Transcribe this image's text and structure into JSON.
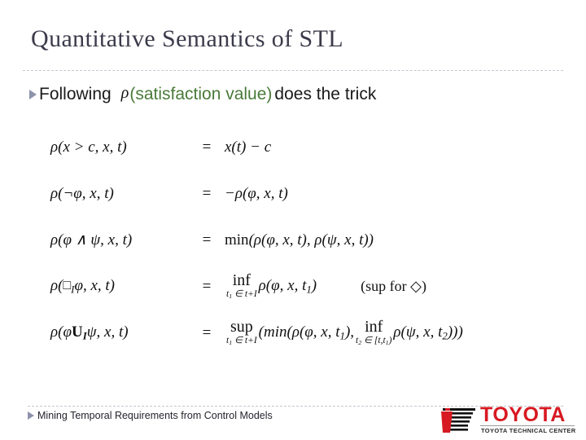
{
  "slide": {
    "title": "Quantitative Semantics of STL",
    "bullet": {
      "marker": "triangle-bullet",
      "lead_text": "Following",
      "rho_symbol": "ρ",
      "highlight_open": "(",
      "highlight_text": "satisfaction value",
      "highlight_close": ")",
      "tail_text": "does the trick",
      "highlight_color": "#4a7a3a"
    },
    "equations": [
      {
        "lhs": "ρ(x > c, x, t)",
        "relation": "=",
        "rhs": "x(t) − c",
        "note": ""
      },
      {
        "lhs": "ρ(¬φ, x, t)",
        "relation": "=",
        "rhs": "−ρ(φ, x, t)",
        "note": ""
      },
      {
        "lhs": "ρ(φ ∧ ψ, x, t)",
        "relation": "=",
        "rhs": "min(ρ(φ, x, t), ρ(ψ, x, t))",
        "note": ""
      },
      {
        "lhs": "ρ(□_I φ, x, t)",
        "relation": "=",
        "rhs": "inf_{t₁ ∈ t+I} ρ(φ, x, t₁)",
        "note": "(sup for ◇)"
      },
      {
        "lhs": "ρ(φ U_I ψ, x, t)",
        "relation": "=",
        "rhs": "sup_{t₁ ∈ t+I} (min(ρ(φ, x, t₁), inf_{t₂ ∈ [t,t₁)} ρ(ψ, x, t₂)))",
        "note": ""
      }
    ],
    "eq_tokens": {
      "r1_lhs_rho": "ρ",
      "r1_lhs_body": "(x > c, x, t)",
      "r1_rhs": "x(t) − c",
      "r2_lhs_rho": "ρ",
      "r2_lhs_body": "(¬φ, x, t)",
      "r2_rhs_sign": "−",
      "r2_rhs_rho": "ρ",
      "r2_rhs_body": "(φ, x, t)",
      "r3_lhs_rho": "ρ",
      "r3_lhs_body": "(φ ∧ ψ, x, t)",
      "r3_rhs_fn": "min",
      "r3_rhs_body": "(ρ(φ, x, t), ρ(ψ, x, t))",
      "r4_lhs_rho": "ρ",
      "r4_lhs_open": "(",
      "r4_lhs_box": "□",
      "r4_lhs_boxsub": "I",
      "r4_lhs_rest": "φ, x, t)",
      "r4_op": "inf",
      "r4_limit_a": "t",
      "r4_limit_sub": "1",
      "r4_limit_b": " ∈ t+I",
      "r4_rhs_tail": "ρ(φ, x, t",
      "r4_rhs_tail_sub": "1",
      "r4_rhs_tail_end": ")",
      "r4_note": "(sup for ◇)",
      "r5_lhs_rho": "ρ",
      "r5_lhs_open": "(φ",
      "r5_lhs_u": "U",
      "r5_lhs_usub": "I",
      "r5_lhs_rest": "ψ, x, t)",
      "r5_op": "sup",
      "r5_limit_a": "t",
      "r5_limit_sub": "1",
      "r5_limit_b": " ∈ t+I",
      "r5_mid_open": "(min(ρ(φ, x, t",
      "r5_mid_sub": "1",
      "r5_mid_close": "), ",
      "r5_op2": "inf",
      "r5_limit2_a": "t",
      "r5_limit2_sub": "2",
      "r5_limit2_b": " ∈ [t,t",
      "r5_limit2_sub2": "1",
      "r5_limit2_end": ")",
      "r5_tail": "ρ(ψ, x, t",
      "r5_tail_sub": "2",
      "r5_tail_end": ")))"
    },
    "footer": {
      "marker": "triangle-bullet",
      "text": "Mining Temporal Requirements from Control Models"
    },
    "logo": {
      "wordmark": "TOYOTA",
      "subtitle": "TOYOTA TECHNICAL CENTER",
      "wordmark_color": "#d71921",
      "mark_color_black": "#111111",
      "mark_color_red": "#d71921"
    }
  }
}
